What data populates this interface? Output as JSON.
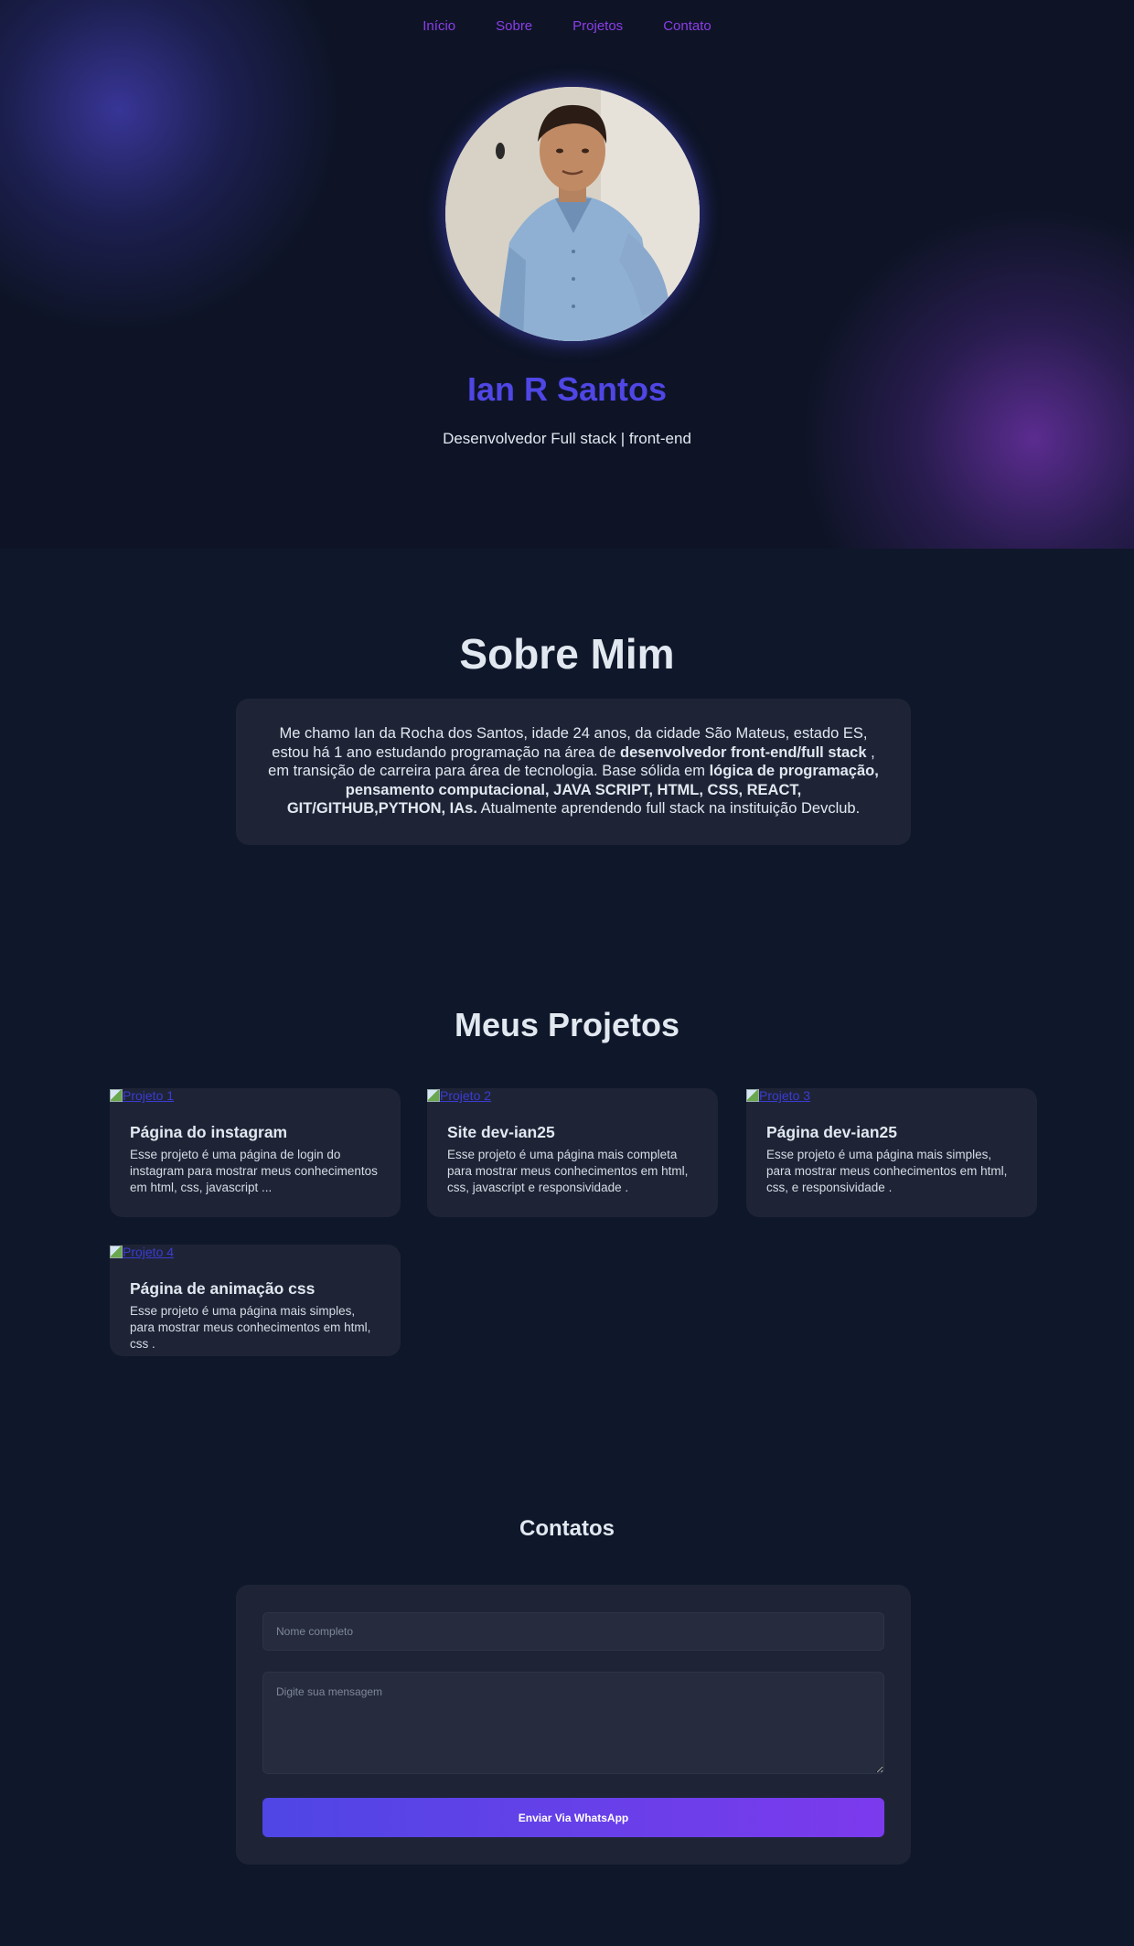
{
  "nav": {
    "items": [
      "Início",
      "Sobre",
      "Projetos",
      "Contato"
    ]
  },
  "hero": {
    "name": "Ian R Santos",
    "role": "Desenvolvedor Full stack | front-end"
  },
  "about": {
    "title": "Sobre Mim",
    "text_1": "Me chamo Ian da Rocha dos Santos, idade 24 anos, da cidade São Mateus, estado ES, estou há 1 ano estudando programação na área de ",
    "bold_1": "desenvolvedor front-end/full stack",
    "text_2": " , em transição de carreira para área de tecnologia. Base sólida em ",
    "bold_2": "lógica de programação, pensamento computacional, JAVA SCRIPT, HTML, CSS, REACT, GIT/GITHUB,PYTHON, IAs.",
    "text_3": " Atualmente aprendendo full stack na instituição Devclub."
  },
  "projects": {
    "title": "Meus Projetos",
    "items": [
      {
        "image_alt": "Projeto 1",
        "name": "Página do instagram",
        "description": "Esse projeto é uma página de login do instagram para mostrar meus conhecimentos em html, css, javascript ..."
      },
      {
        "image_alt": "Projeto 2",
        "name": "Site dev-ian25",
        "description": "Esse projeto é uma página mais completa para mostrar meus conhecimentos em html, css, javascript e responsividade ."
      },
      {
        "image_alt": "Projeto 3",
        "name": "Página dev-ian25",
        "description": "Esse projeto é uma página mais simples, para mostrar meus conhecimentos em html, css, e responsividade ."
      },
      {
        "image_alt": "Projeto 4",
        "name": "Página de animação css",
        "description": "Esse projeto é uma página mais simples, para mostrar meus conhecimentos em html, css ."
      }
    ]
  },
  "contact": {
    "title": "Contatos",
    "name_placeholder": "Nome completo",
    "message_placeholder": "Digite sua mensagem",
    "submit_label": "Enviar Via WhatsApp"
  },
  "colors": {
    "background": "#0f172a",
    "accent": "#4f46e5",
    "nav_link": "#8b3ee8",
    "card": "#1e2436"
  }
}
